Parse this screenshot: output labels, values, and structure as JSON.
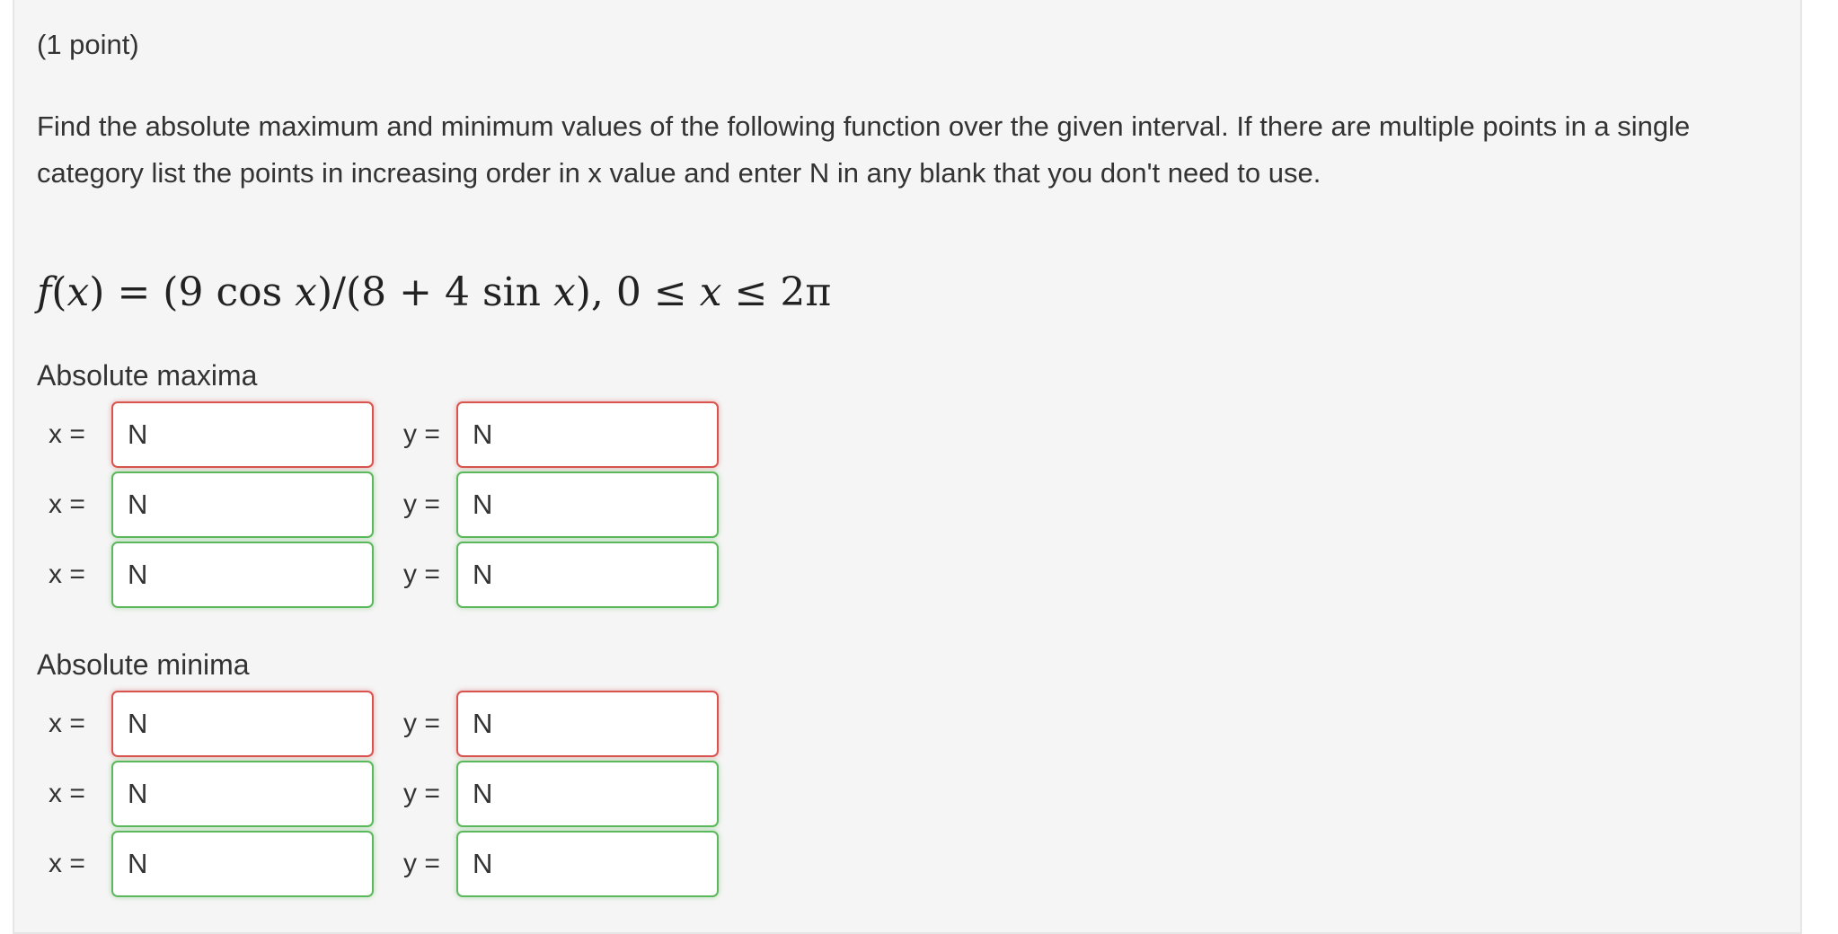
{
  "problem": {
    "points": "(1 point)",
    "question": "Find the absolute maximum and minimum values of the following function over the given interval. If there are multiple points in a single category list the points in increasing order in x value and enter N in any blank that you don't need to use.",
    "formula": {
      "f": "f",
      "lparen": "(",
      "x": "x",
      "rparen_eq": ") = (9 cos ",
      "x2": "x",
      "mid": ")/(8 + 4 sin ",
      "x3": "x",
      "end": "),  0 ≤ ",
      "x4": "x",
      "tail": " ≤ 2π"
    }
  },
  "maxima": {
    "title": "Absolute maxima",
    "rows": [
      {
        "x_label": "x =",
        "x_value": "N",
        "y_label": "y =",
        "y_value": "N",
        "status": "incorrect"
      },
      {
        "x_label": "x =",
        "x_value": "N",
        "y_label": "y =",
        "y_value": "N",
        "status": "correct"
      },
      {
        "x_label": "x =",
        "x_value": "N",
        "y_label": "y =",
        "y_value": "N",
        "status": "correct"
      }
    ]
  },
  "minima": {
    "title": "Absolute minima",
    "rows": [
      {
        "x_label": "x =",
        "x_value": "N",
        "y_label": "y =",
        "y_value": "N",
        "status": "incorrect"
      },
      {
        "x_label": "x =",
        "x_value": "N",
        "y_label": "y =",
        "y_value": "N",
        "status": "correct"
      },
      {
        "x_label": "x =",
        "x_value": "N",
        "y_label": "y =",
        "y_value": "N",
        "status": "correct"
      }
    ]
  },
  "colors": {
    "panel_bg": "#f5f5f5",
    "incorrect_border": "#d9534f",
    "correct_border": "#5cb85c"
  }
}
